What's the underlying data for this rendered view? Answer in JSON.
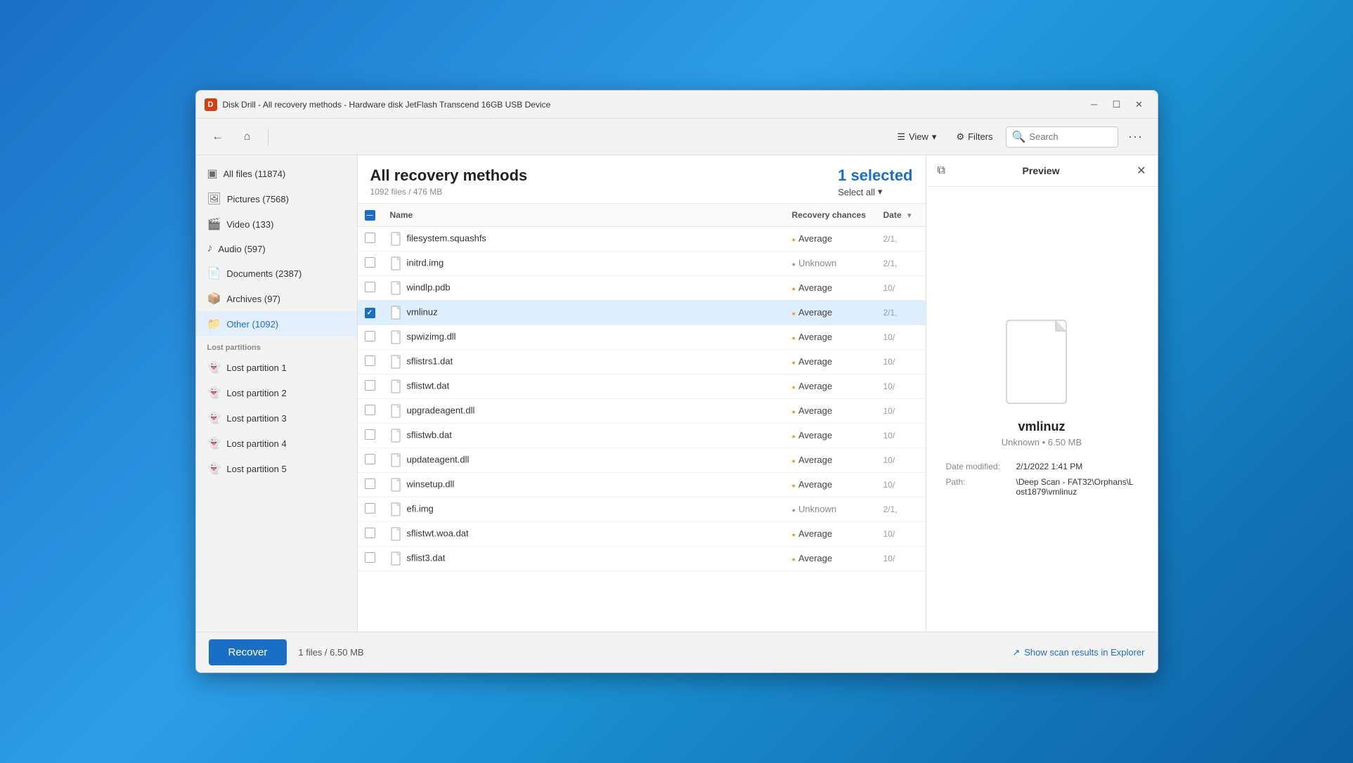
{
  "window": {
    "title": "Disk Drill - All recovery methods - Hardware disk JetFlash Transcend 16GB USB Device"
  },
  "titlebar": {
    "minimize_label": "─",
    "maximize_label": "☐",
    "close_label": "✕"
  },
  "toolbar": {
    "back_title": "Back",
    "home_title": "Home",
    "view_label": "View",
    "filters_label": "Filters",
    "search_placeholder": "Search",
    "more_label": "..."
  },
  "sidebar": {
    "items": [
      {
        "id": "all-files",
        "label": "All files (11874)",
        "icon": "▣"
      },
      {
        "id": "pictures",
        "label": "Pictures (7568)",
        "icon": "🖼"
      },
      {
        "id": "video",
        "label": "Video (133)",
        "icon": "🎬"
      },
      {
        "id": "audio",
        "label": "Audio (597)",
        "icon": "♪"
      },
      {
        "id": "documents",
        "label": "Documents (2387)",
        "icon": "📄"
      },
      {
        "id": "archives",
        "label": "Archives (97)",
        "icon": "📦"
      },
      {
        "id": "other",
        "label": "Other (1092)",
        "icon": "📁"
      }
    ],
    "lost_partitions_label": "Lost partitions",
    "lost_partitions": [
      {
        "id": "lp1",
        "label": "Lost partition 1"
      },
      {
        "id": "lp2",
        "label": "Lost partition 2"
      },
      {
        "id": "lp3",
        "label": "Lost partition 3"
      },
      {
        "id": "lp4",
        "label": "Lost partition 4"
      },
      {
        "id": "lp5",
        "label": "Lost partition 5"
      }
    ]
  },
  "file_area": {
    "title": "All recovery methods",
    "subtitle": "1092 files / 476 MB",
    "selected_count": "1 selected",
    "select_all_label": "Select all",
    "columns": {
      "name": "Name",
      "recovery_chances": "Recovery chances",
      "date": "Date"
    },
    "files": [
      {
        "name": "filesystem.squashfs",
        "chances": "Average",
        "chances_type": "average",
        "date": "2/1,"
      },
      {
        "name": "initrd.img",
        "chances": "Unknown",
        "chances_type": "unknown",
        "date": "2/1,"
      },
      {
        "name": "windlp.pdb",
        "chances": "Average",
        "chances_type": "average",
        "date": "10/"
      },
      {
        "name": "vmlinuz",
        "chances": "Average",
        "chances_type": "average",
        "date": "2/1,",
        "selected": true
      },
      {
        "name": "spwizimg.dll",
        "chances": "Average",
        "chances_type": "average",
        "date": "10/"
      },
      {
        "name": "sflistrs1.dat",
        "chances": "Average",
        "chances_type": "average",
        "date": "10/"
      },
      {
        "name": "sflistwt.dat",
        "chances": "Average",
        "chances_type": "average",
        "date": "10/"
      },
      {
        "name": "upgradeagent.dll",
        "chances": "Average",
        "chances_type": "average",
        "date": "10/"
      },
      {
        "name": "sflistwb.dat",
        "chances": "Average",
        "chances_type": "average",
        "date": "10/"
      },
      {
        "name": "updateagent.dll",
        "chances": "Average",
        "chances_type": "average",
        "date": "10/"
      },
      {
        "name": "winsetup.dll",
        "chances": "Average",
        "chances_type": "average",
        "date": "10/"
      },
      {
        "name": "efi.img",
        "chances": "Unknown",
        "chances_type": "unknown",
        "date": "2/1,"
      },
      {
        "name": "sflistwt.woa.dat",
        "chances": "Average",
        "chances_type": "average",
        "date": "10/"
      },
      {
        "name": "sflist3.dat",
        "chances": "Average",
        "chances_type": "average",
        "date": "10/"
      }
    ]
  },
  "preview": {
    "title": "Preview",
    "filename": "vmlinuz",
    "fileinfo": "Unknown • 6.50 MB",
    "date_modified_label": "Date modified:",
    "date_modified_value": "2/1/2022 1:41 PM",
    "path_label": "Path:",
    "path_value": "\\Deep Scan - FAT32\\Orphans\\Lost1879\\vmlinuz"
  },
  "bottom_bar": {
    "recover_label": "Recover",
    "files_info": "1 files / 6.50 MB",
    "show_in_explorer_label": "Show scan results in Explorer"
  }
}
